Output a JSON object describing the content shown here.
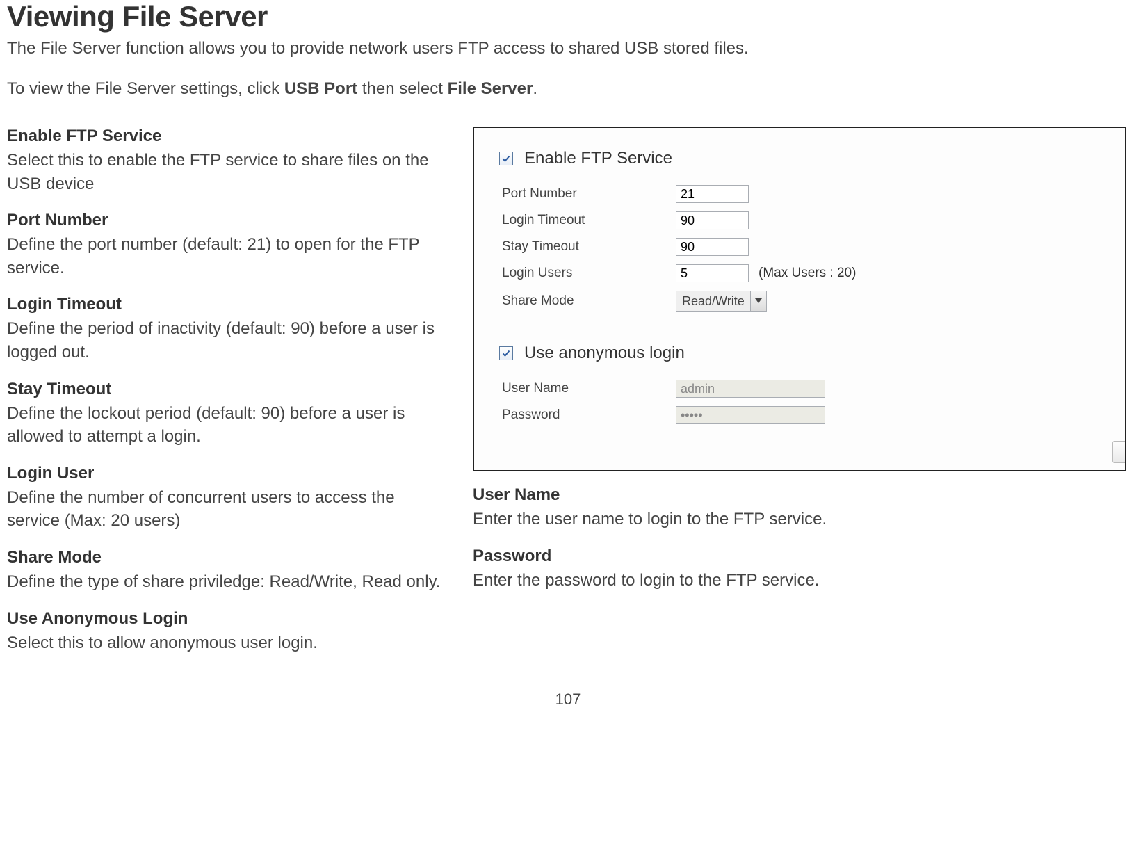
{
  "heading": "Viewing File Server",
  "intro": "The File Server function allows you to provide network users FTP access to shared USB stored files.",
  "howto_prefix": "To view the File Server settings, click ",
  "howto_bold1": "USB Port",
  "howto_mid": " then select ",
  "howto_bold2": "File Server",
  "howto_suffix": ".",
  "left": {
    "enable_ftp": {
      "title": "Enable FTP Service",
      "desc": "Select this to enable the FTP service to share files on the USB device"
    },
    "port_number": {
      "title": "Port Number",
      "desc": "Define the port number (default: 21) to open for the FTP service."
    },
    "login_timeout": {
      "title": "Login Timeout",
      "desc": "Define the period of inactivity (default: 90) before a user is logged out."
    },
    "stay_timeout": {
      "title": "Stay Timeout",
      "desc": "Define the lockout period (default: 90) before a user is allowed to attempt a login."
    },
    "login_user": {
      "title": "Login User",
      "desc": "Define the number of concurrent users to access the service (Max: 20 users)"
    },
    "share_mode": {
      "title": "Share Mode",
      "desc": "Define the type of share priviledge: Read/Write, Read only."
    },
    "use_anon": {
      "title": "Use Anonymous Login",
      "desc": "Select this to allow anonymous user login."
    }
  },
  "right": {
    "user_name": {
      "title": "User Name",
      "desc": "Enter the user name to login to the FTP service."
    },
    "password": {
      "title": "Password",
      "desc": "Enter the password to login to the FTP service."
    }
  },
  "panel": {
    "enable_ftp_label": "Enable FTP Service",
    "port_number_label": "Port Number",
    "port_number_value": "21",
    "login_timeout_label": "Login Timeout",
    "login_timeout_value": "90",
    "stay_timeout_label": "Stay Timeout",
    "stay_timeout_value": "90",
    "login_users_label": "Login Users",
    "login_users_value": "5",
    "login_users_note": "(Max Users : 20)",
    "share_mode_label": "Share Mode",
    "share_mode_value": "Read/Write",
    "use_anon_label": "Use anonymous login",
    "user_name_label": "User Name",
    "user_name_value": "admin",
    "password_label": "Password",
    "password_value": "•••••"
  },
  "page_number": "107"
}
